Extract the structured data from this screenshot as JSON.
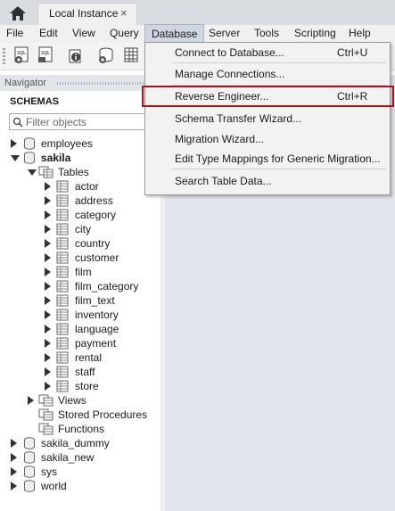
{
  "tab": {
    "title": "Local Instance",
    "close": "×"
  },
  "menubar": [
    "File",
    "Edit",
    "View",
    "Query",
    "Database",
    "Server",
    "Tools",
    "Scripting",
    "Help"
  ],
  "active_menu": "Database",
  "navigator": {
    "title": "Navigator",
    "schemas_label": "SCHEMAS",
    "filter_placeholder": "Filter objects"
  },
  "schemas": {
    "employees": "employees",
    "sakila": "sakila",
    "folders": {
      "tables": "Tables",
      "views": "Views",
      "procs": "Stored Procedures",
      "funcs": "Functions"
    },
    "tables": [
      "actor",
      "address",
      "category",
      "city",
      "country",
      "customer",
      "film",
      "film_category",
      "film_text",
      "inventory",
      "language",
      "payment",
      "rental",
      "staff",
      "store"
    ],
    "others": [
      "sakila_dummy",
      "sakila_new",
      "sys",
      "world"
    ]
  },
  "dropdown": {
    "items": [
      {
        "label": "Connect to Database...",
        "shortcut": "Ctrl+U"
      },
      {
        "label": "Manage Connections...",
        "shortcut": ""
      },
      {
        "label": "Reverse Engineer...",
        "shortcut": "Ctrl+R"
      },
      {
        "label": "Schema Transfer Wizard...",
        "shortcut": ""
      },
      {
        "label": "Migration Wizard...",
        "shortcut": ""
      },
      {
        "label": "Edit Type Mappings for Generic Migration...",
        "shortcut": ""
      },
      {
        "label": "Search Table Data...",
        "shortcut": ""
      }
    ],
    "highlighted": "Reverse Engineer..."
  },
  "toolbar_icons": [
    "new-sql-tab-icon",
    "open-sql-script-icon",
    "info-icon",
    "create-schema-icon",
    "create-table-icon"
  ],
  "colors": {
    "highlight_border": "#b0121b",
    "menu_active": "#cfd6e0"
  }
}
